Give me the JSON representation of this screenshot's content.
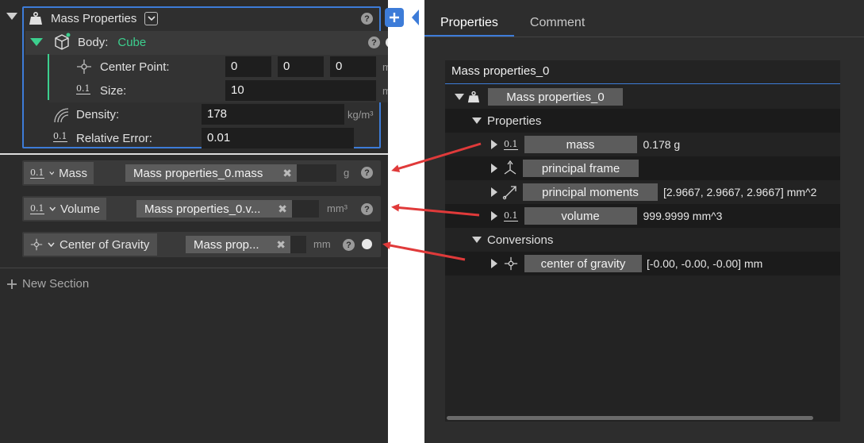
{
  "left": {
    "section_title": "Mass Properties",
    "body_label": "Body:",
    "body_value": "Cube",
    "center_point_label": "Center Point:",
    "center_point": [
      "0",
      "0",
      "0"
    ],
    "center_point_unit": "mm",
    "size_label": "Size:",
    "size_value": "10",
    "size_unit": "mm",
    "density_label": "Density:",
    "density_value": "178",
    "density_unit": "kg/m³",
    "rel_error_label": "Relative Error:",
    "rel_error_value": "0.01",
    "icon_01": "0.1",
    "outputs": [
      {
        "label": "Mass",
        "ref": "Mass properties_0.mass",
        "unit": "g"
      },
      {
        "label": "Volume",
        "ref": "Mass properties_0.v...",
        "unit": "mm³"
      },
      {
        "label": "Center of Gravity",
        "ref": "Mass prop...",
        "unit": "mm"
      }
    ],
    "new_section": "New Section",
    "accent_color": "#3d7cd8",
    "green_color": "#3ccf8e"
  },
  "right": {
    "tabs": [
      "Properties",
      "Comment"
    ],
    "panel_title": "Mass properties_0",
    "root_label": "Mass properties_0",
    "group_properties": "Properties",
    "group_conversions": "Conversions",
    "items": [
      {
        "label": "mass",
        "value": "0.178 g"
      },
      {
        "label": "principal frame",
        "value": ""
      },
      {
        "label": "principal moments",
        "value": "[2.9667, 2.9667, 2.9667] mm^2"
      },
      {
        "label": "volume",
        "value": "999.9999 mm^3"
      }
    ],
    "conv_item": {
      "label": "center of gravity",
      "value": "[-0.00, -0.00, -0.00] mm"
    }
  },
  "icons": {
    "weight": "weight-icon",
    "cube": "cube-icon",
    "crosshair": "crosshair-icon",
    "density": "density-icon",
    "frame": "axes-icon",
    "moments": "vector-icon",
    "help": "help-icon",
    "plus": "plus-icon"
  }
}
